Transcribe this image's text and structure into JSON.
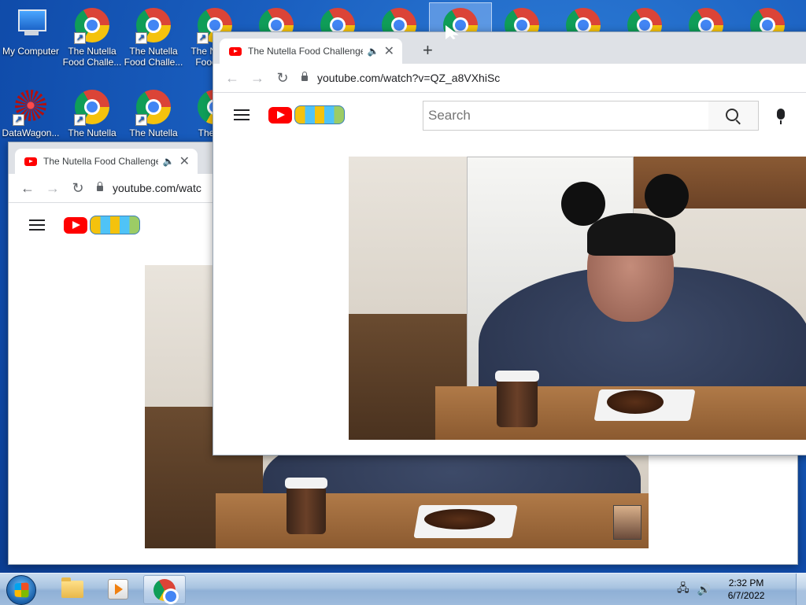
{
  "desktop": {
    "icons": [
      {
        "label": "My Computer",
        "type": "computer"
      },
      {
        "label": "The Nutella Food Challe...",
        "type": "chrome"
      },
      {
        "label": "The Nutella Food Challe...",
        "type": "chrome"
      },
      {
        "label": "The Nutella Food C...",
        "type": "chrome"
      },
      {
        "label": "DataWagon...",
        "type": "datawagon"
      },
      {
        "label": "The Nutella",
        "type": "chrome"
      },
      {
        "label": "The Nutella",
        "type": "chrome"
      },
      {
        "label": "The N...",
        "type": "chrome"
      }
    ]
  },
  "front_window": {
    "tab_title": "The Nutella Food Challenge",
    "tab_audio_icon": "speaker-icon",
    "tab_close": "✕",
    "new_tab": "+",
    "url": "youtube.com/watch?v=QZ_a8VXhiSc",
    "search_placeholder": "Search"
  },
  "back_window": {
    "tab_title": "The Nutella Food Challenge",
    "tab_close": "✕",
    "url": "youtube.com/watc"
  },
  "taskbar": {
    "time": "2:32 PM",
    "date": "6/7/2022"
  },
  "colors": {
    "youtube_red": "#ff0000",
    "desktop_blue": "#1a5fc0"
  }
}
